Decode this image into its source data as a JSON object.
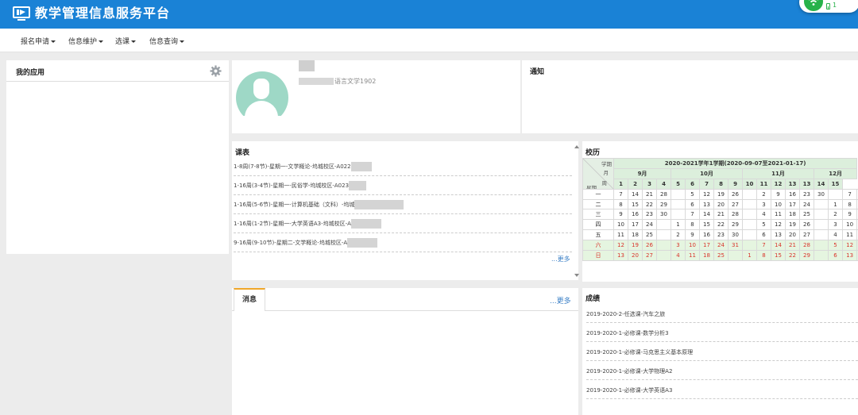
{
  "header": {
    "title": "教学管理信息服务平台",
    "wifi_count": "1"
  },
  "menu": [
    {
      "label": "报名申请"
    },
    {
      "label": "信息维护"
    },
    {
      "label": "选课"
    },
    {
      "label": "信息查询"
    }
  ],
  "apps": {
    "title": "我的应用"
  },
  "profile": {
    "class_name": "语言文学1902"
  },
  "notice": {
    "title": "通知"
  },
  "schedule": {
    "title": "课表",
    "more": "...更多",
    "rows": [
      "1-8周(7-8节)-星期一-文学概论-坞城校区-A022",
      "1-16周(3-4节)-星期一-民俗学-坞城校区-A023",
      "1-16周(5-6节)-星期一-计算机基础（文科）-坞城",
      "1-16周(1-2节)-星期一-大学英语A3-坞城校区-A",
      "9-16周(9-10节)-星期二-文学概论-坞城校区-A"
    ]
  },
  "calendar": {
    "title": "校历",
    "semester": "2020-2021学年1学期(2020-09-07至2021-01-17)",
    "corner": {
      "xueqi": "学期",
      "yue": "月",
      "zhou": "周",
      "xingqi": "星期"
    },
    "months": [
      "9月",
      "10月",
      "11月",
      "12月"
    ],
    "weeks": [
      "1",
      "2",
      "3",
      "4",
      "5",
      "6",
      "7",
      "8",
      "9",
      "10",
      "11",
      "12",
      "13",
      "13",
      "14",
      "15"
    ],
    "days": [
      {
        "label": "一",
        "cells": [
          "7",
          "14",
          "21",
          "28",
          "",
          "5",
          "12",
          "19",
          "26",
          "",
          "2",
          "9",
          "16",
          "23",
          "30",
          "",
          "7",
          "14"
        ],
        "weekend": false
      },
      {
        "label": "二",
        "cells": [
          "8",
          "15",
          "22",
          "29",
          "",
          "6",
          "13",
          "20",
          "27",
          "",
          "3",
          "10",
          "17",
          "24",
          "",
          "1",
          "8",
          "15"
        ],
        "weekend": false
      },
      {
        "label": "三",
        "cells": [
          "9",
          "16",
          "23",
          "30",
          "",
          "7",
          "14",
          "21",
          "28",
          "",
          "4",
          "11",
          "18",
          "25",
          "",
          "2",
          "9",
          "16"
        ],
        "weekend": false
      },
      {
        "label": "四",
        "cells": [
          "10",
          "17",
          "24",
          "",
          "1",
          "8",
          "15",
          "22",
          "29",
          "",
          "5",
          "12",
          "19",
          "26",
          "",
          "3",
          "10",
          "17"
        ],
        "weekend": false
      },
      {
        "label": "五",
        "cells": [
          "11",
          "18",
          "25",
          "",
          "2",
          "9",
          "16",
          "23",
          "30",
          "",
          "6",
          "13",
          "20",
          "27",
          "",
          "4",
          "11",
          "18"
        ],
        "weekend": false
      },
      {
        "label": "六",
        "cells": [
          "12",
          "19",
          "26",
          "",
          "3",
          "10",
          "17",
          "24",
          "31",
          "",
          "7",
          "14",
          "21",
          "28",
          "",
          "5",
          "12",
          "19"
        ],
        "weekend": true
      },
      {
        "label": "日",
        "cells": [
          "13",
          "20",
          "27",
          "",
          "4",
          "11",
          "18",
          "25",
          "",
          "1",
          "8",
          "15",
          "22",
          "29",
          "",
          "6",
          "13",
          "20"
        ],
        "weekend": true
      }
    ]
  },
  "messages": {
    "tab": "消息",
    "more": "...更多"
  },
  "grades": {
    "title": "成绩",
    "rows": [
      "2019-2020-2-任选课-汽车之旅",
      "2019-2020-1-必修课-数学分析3",
      "2019-2020-1-必修课-马克思主义基本原理",
      "2019-2020-1-必修课-大学物理A2",
      "2019-2020-1-必修课-大学英语A3"
    ]
  },
  "colors": {
    "header": "#1a82d6",
    "accent": "#f0a72a",
    "link": "#3a7fc6",
    "weekend_text": "#d9342b",
    "avatar": "#9ed8c6"
  }
}
